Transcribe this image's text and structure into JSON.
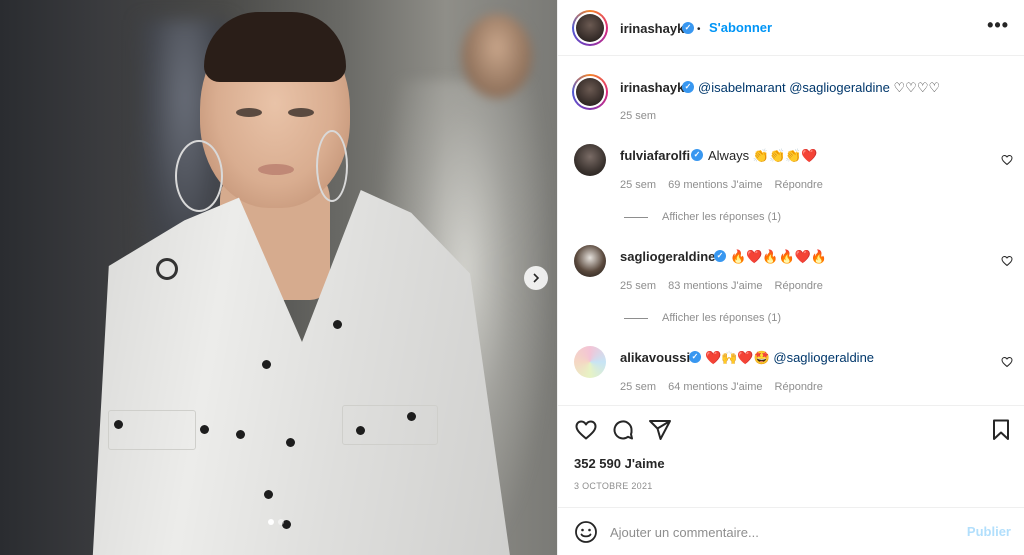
{
  "post": {
    "author": "irinashayk",
    "follow_label": "S'abonner",
    "separator": "•",
    "more_label": "•••",
    "caption": {
      "user": "irinashayk",
      "mentions": "@isabelmarant @sagliogeraldine",
      "hearts": "♡♡♡♡",
      "time": "25 sem"
    },
    "carousel": {
      "count": 3,
      "active": 1
    }
  },
  "comments": [
    {
      "user": "fulviafarolfi",
      "text": "Always",
      "emoji": "👏👏👏❤️",
      "time": "25 sem",
      "likes": "69 mentions J'aime",
      "reply": "Répondre",
      "view_replies": "Afficher les réponses (1)"
    },
    {
      "user": "sagliogeraldine",
      "text": "",
      "emoji": "🔥❤️🔥🔥❤️🔥",
      "time": "25 sem",
      "likes": "83 mentions J'aime",
      "reply": "Répondre",
      "view_replies": "Afficher les réponses (1)"
    },
    {
      "user": "alikavoussi",
      "text": "",
      "emoji": "❤️🙌❤️🤩",
      "mention": "@sagliogeraldine",
      "time": "25 sem",
      "likes": "64 mentions J'aime",
      "reply": "Répondre"
    }
  ],
  "stats": {
    "likes": "352 590 J'aime",
    "date": "3 OCTOBRE 2021"
  },
  "comment_box": {
    "placeholder": "Ajouter un commentaire...",
    "publish_label": "Publier"
  },
  "colors": {
    "link": "#0095f6",
    "verified": "#3897f0",
    "muted": "#8e8e8e",
    "publish_disabled": "#b2dffc"
  },
  "icons": [
    "like-icon",
    "comment-icon",
    "share-icon",
    "save-icon",
    "emoji-icon",
    "chevron-right-icon",
    "verified-icon",
    "heart-small-icon"
  ]
}
